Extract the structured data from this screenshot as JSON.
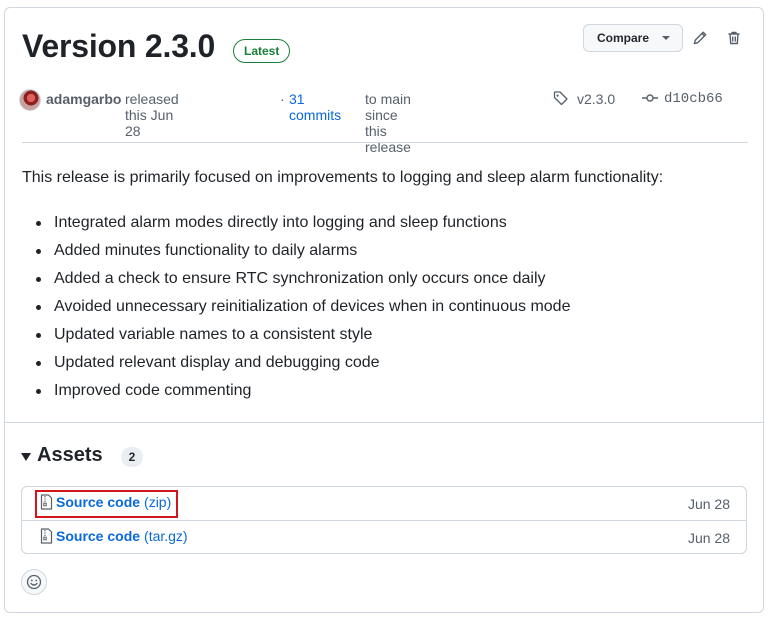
{
  "release": {
    "title": "Version 2.3.0",
    "badge": "Latest"
  },
  "actions": {
    "compare_label": "Compare",
    "edit_icon": "pencil-icon",
    "delete_icon": "trash-icon"
  },
  "meta": {
    "author": "adamgarbo",
    "released_text": "released this Jun 28",
    "separator": "·",
    "commits_link": "31 commits",
    "since_text": "to main since this release",
    "tag": "v2.3.0",
    "commit_sha": "d10cb66"
  },
  "body": {
    "intro": "This release is primarily focused on improvements to logging and sleep alarm functionality:",
    "bullets": [
      "Integrated alarm modes directly into logging and sleep functions",
      "Added minutes functionality to daily alarms",
      "Added a check to ensure RTC synchronization only occurs once daily",
      "Avoided unnecessary reinitialization of devices when in continuous mode",
      "Updated variable names to a consistent style",
      "Updated relevant display and debugging code",
      "Improved code commenting"
    ]
  },
  "assets": {
    "heading": "Assets",
    "count": "2",
    "items": [
      {
        "name": "Source code",
        "ext": "(zip)",
        "date": "Jun 28"
      },
      {
        "name": "Source code",
        "ext": "(tar.gz)",
        "date": "Jun 28"
      }
    ]
  },
  "colors": {
    "link": "#0969da",
    "badge_green": "#1a7f37",
    "highlight_red": "#d0161b",
    "border": "#d0d7de"
  }
}
